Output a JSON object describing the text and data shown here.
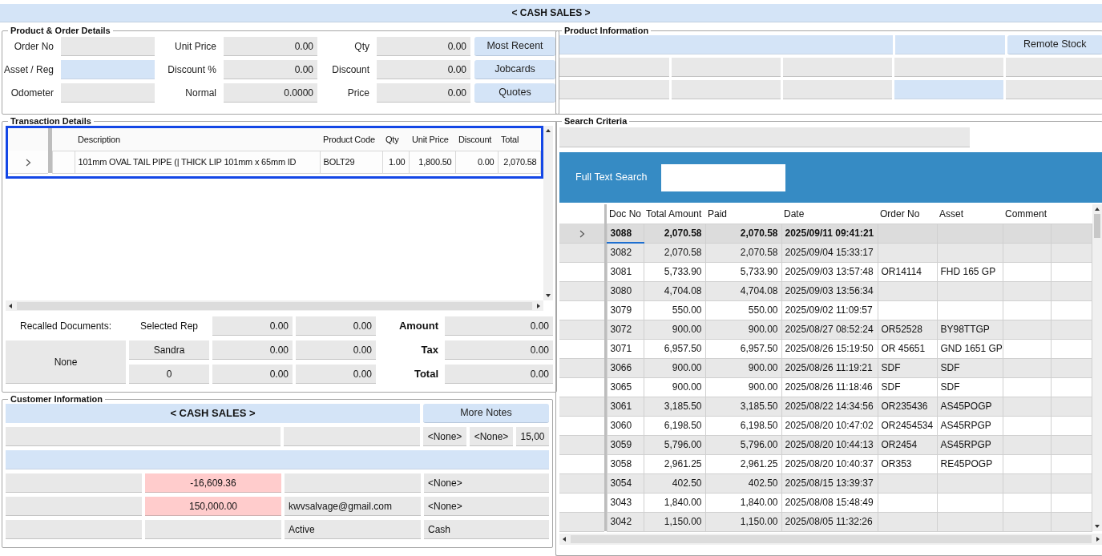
{
  "header": {
    "title": "< CASH SALES >"
  },
  "product_order_details": {
    "title": "Product & Order Details",
    "rows": [
      [
        {
          "kind": "label",
          "text": "Order No"
        },
        {
          "kind": "field"
        },
        {
          "kind": "label",
          "text": "Unit Price"
        },
        {
          "kind": "field",
          "text": "0.00"
        },
        {
          "kind": "label",
          "text": "Qty"
        },
        {
          "kind": "field",
          "text": "0.00"
        },
        {
          "kind": "button",
          "text": "Most Recent"
        }
      ],
      [
        {
          "kind": "label",
          "text": "Asset / Reg"
        },
        {
          "kind": "input"
        },
        {
          "kind": "label",
          "text": "Discount %"
        },
        {
          "kind": "field",
          "text": "0.00"
        },
        {
          "kind": "label",
          "text": "Discount"
        },
        {
          "kind": "field",
          "text": "0.00"
        },
        {
          "kind": "button",
          "text": "Jobcards"
        }
      ],
      [
        {
          "kind": "label",
          "text": "Odometer"
        },
        {
          "kind": "field"
        },
        {
          "kind": "label",
          "text": "Normal"
        },
        {
          "kind": "field",
          "text": "0.0000"
        },
        {
          "kind": "label",
          "text": "Price"
        },
        {
          "kind": "field",
          "text": "0.00"
        },
        {
          "kind": "button",
          "text": "Quotes"
        }
      ]
    ]
  },
  "transaction_details": {
    "title": "Transaction Details",
    "focused": true,
    "columns": [
      "Description",
      "Product Code",
      "Qty",
      "Unit Price",
      "Discount",
      "Total"
    ],
    "rows": [
      {
        "selected": true,
        "cells": [
          "101mm OVAL TAIL PIPE (| THICK LIP 101mm x 65mm ID",
          "BOLT29",
          "1.00",
          "1,800.50",
          "0.00",
          "2,070.58"
        ]
      }
    ],
    "summary": {
      "recalled": {
        "label": "Recalled Documents:",
        "value": "None"
      },
      "rep": {
        "label": "Selected Rep",
        "values": [
          "Sandra",
          "0"
        ]
      },
      "amounts": [
        [
          "0.00",
          "0.00"
        ],
        [
          "0.00",
          "0.00"
        ],
        [
          "0.00",
          "0.00"
        ]
      ],
      "totals": [
        {
          "label": "Amount",
          "value": "0.00"
        },
        {
          "label": "Tax",
          "value": "0.00"
        },
        {
          "label": "Total",
          "value": "0.00"
        }
      ]
    }
  },
  "customer_information": {
    "title": "Customer Information",
    "name_row": [
      {
        "kind": "title",
        "text": "< CASH SALES >"
      },
      {
        "kind": "button",
        "text": "More Notes"
      }
    ],
    "options_row": [
      {
        "kind": "field"
      },
      {
        "kind": "field"
      },
      {
        "kind": "field",
        "text": "<None>"
      },
      {
        "kind": "field",
        "text": "<None>"
      },
      {
        "kind": "field",
        "text": "15,00"
      }
    ],
    "note_bar": {
      "kind": "input"
    },
    "rows": [
      [
        {
          "kind": "field"
        },
        {
          "kind": "alert",
          "text": "-16,609.36"
        },
        {
          "kind": "field"
        },
        {
          "kind": "field",
          "text": "<None>"
        }
      ],
      [
        {
          "kind": "field"
        },
        {
          "kind": "alert",
          "text": "150,000.00"
        },
        {
          "kind": "field",
          "text": "kwvsalvage@gmail.com"
        },
        {
          "kind": "field",
          "text": "<None>"
        }
      ],
      [
        {
          "kind": "field"
        },
        {
          "kind": "field"
        },
        {
          "kind": "field",
          "text": "Active"
        },
        {
          "kind": "field",
          "text": "Cash"
        }
      ]
    ]
  },
  "product_information": {
    "title": "Product Information",
    "rows": [
      [
        {
          "kind": "input"
        },
        {
          "kind": "input"
        },
        {
          "kind": "button",
          "text": "Remote Stock"
        }
      ],
      [
        {
          "kind": "field"
        },
        {
          "kind": "field"
        },
        {
          "kind": "field"
        },
        {
          "kind": "field"
        },
        {
          "kind": "field"
        }
      ],
      [
        {
          "kind": "field"
        },
        {
          "kind": "field"
        },
        {
          "kind": "field"
        },
        {
          "kind": "input"
        },
        {
          "kind": "field"
        }
      ]
    ]
  },
  "search_criteria": {
    "title": "Search Criteria",
    "full_text_search": {
      "label": "Full Text Search"
    },
    "columns": [
      "Doc No",
      "Total Amount",
      "Paid",
      "Date",
      "Order No",
      "Asset",
      "Comment"
    ],
    "rows": [
      {
        "selected": true,
        "doc_no": "3088",
        "total_amount": "2,070.58",
        "paid": "2,070.58",
        "date": "2025/09/11 09:41:21"
      },
      {
        "selected": false,
        "doc_no": "3082",
        "total_amount": "2,070.58",
        "paid": "2,070.58",
        "date": "2025/09/04 15:33:17"
      },
      {
        "selected": false,
        "doc_no": "3081",
        "total_amount": "5,733.90",
        "paid": "5,733.90",
        "date": "2025/09/03 13:57:48",
        "order_no": "OR14114",
        "asset": "FHD 165 GP"
      },
      {
        "selected": false,
        "doc_no": "3080",
        "total_amount": "4,704.08",
        "paid": "4,704.08",
        "date": "2025/09/03 13:56:34"
      },
      {
        "selected": false,
        "doc_no": "3079",
        "total_amount": "550.00",
        "paid": "550.00",
        "date": "2025/09/02 11:09:57"
      },
      {
        "selected": false,
        "doc_no": "3072",
        "total_amount": "900.00",
        "paid": "900.00",
        "date": "2025/08/27 08:52:24",
        "order_no": "OR52528",
        "asset": "BY98TTGP"
      },
      {
        "selected": false,
        "doc_no": "3071",
        "total_amount": "6,957.50",
        "paid": "6,957.50",
        "date": "2025/08/26 15:19:50",
        "order_no": "OR 45651",
        "asset": "GND 1651 GP"
      },
      {
        "selected": false,
        "doc_no": "3066",
        "total_amount": "900.00",
        "paid": "900.00",
        "date": "2025/08/26 11:19:21",
        "order_no": "SDF",
        "asset": "SDF"
      },
      {
        "selected": false,
        "doc_no": "3065",
        "total_amount": "900.00",
        "paid": "900.00",
        "date": "2025/08/26 11:18:46",
        "order_no": "SDF",
        "asset": "SDF"
      },
      {
        "selected": false,
        "doc_no": "3061",
        "total_amount": "3,185.50",
        "paid": "3,185.50",
        "date": "2025/08/22 14:34:56",
        "order_no": "OR235436",
        "asset": "AS45POGP"
      },
      {
        "selected": false,
        "doc_no": "3060",
        "total_amount": "6,198.50",
        "paid": "6,198.50",
        "date": "2025/08/20 10:47:02",
        "order_no": "OR2454534",
        "asset": "AS45RPGP"
      },
      {
        "selected": false,
        "doc_no": "3059",
        "total_amount": "5,796.00",
        "paid": "5,796.00",
        "date": "2025/08/20 10:44:13",
        "order_no": "OR2454",
        "asset": "AS45RPGP"
      },
      {
        "selected": false,
        "doc_no": "3058",
        "total_amount": "2,961.25",
        "paid": "2,961.25",
        "date": "2025/08/20 10:40:37",
        "order_no": "OR353",
        "asset": "RE45POGP"
      },
      {
        "selected": false,
        "doc_no": "3054",
        "total_amount": "402.50",
        "paid": "402.50",
        "date": "2025/08/15 13:39:37"
      },
      {
        "selected": false,
        "doc_no": "3043",
        "total_amount": "1,840.00",
        "paid": "1,840.00",
        "date": "2025/08/08 15:48:49"
      },
      {
        "selected": false,
        "doc_no": "3042",
        "total_amount": "1,150.00",
        "paid": "1,150.00",
        "date": "2025/08/05 11:32:26"
      }
    ]
  }
}
